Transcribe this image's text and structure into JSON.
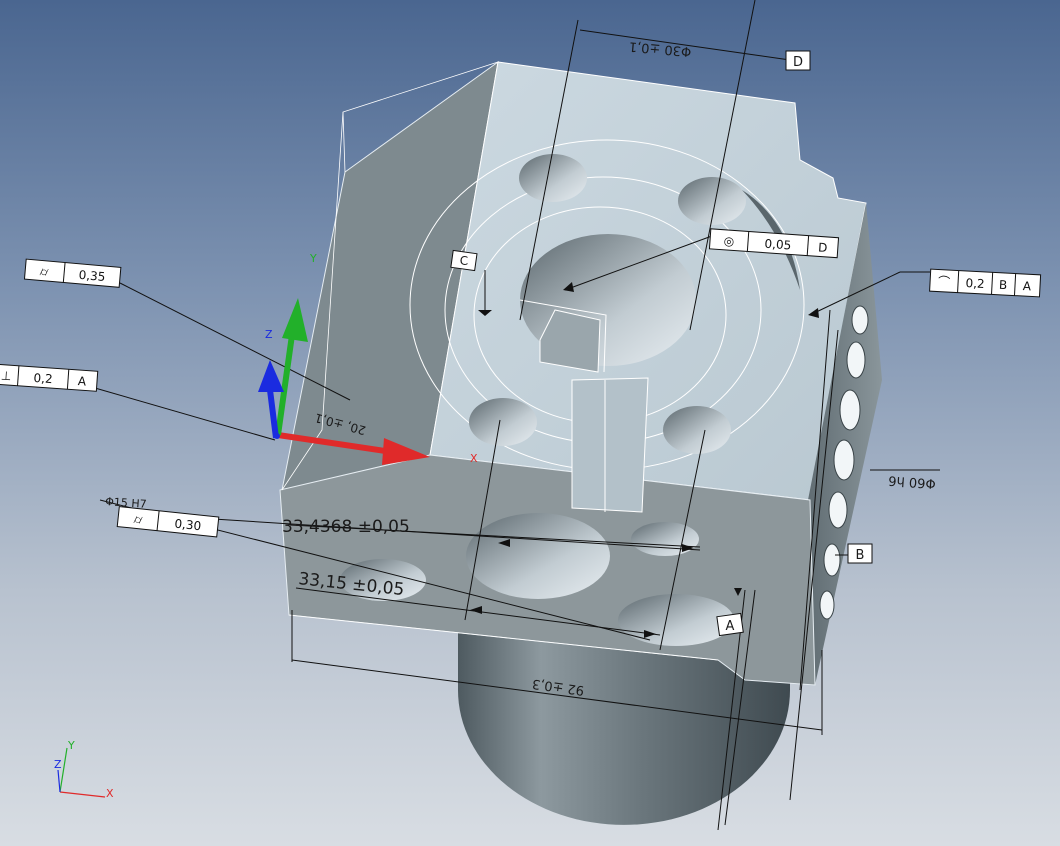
{
  "view": {
    "model_name": "",
    "colors": {
      "background_top": "#4a6690",
      "background_bottom": "#d8dde3",
      "top_face": "#c5d3dc",
      "side_face": "#7d8a90",
      "front_face": "#8b9599",
      "x_axis": "#e02a2a",
      "y_axis": "#22b02a",
      "z_axis": "#1a2be0"
    }
  },
  "triad": {
    "main": {
      "x_label": "X",
      "y_label": "Y",
      "z_label": "Z"
    },
    "corner": {
      "x_label": "X",
      "y_label": "Y",
      "z_label": "Z"
    }
  },
  "dimensions": {
    "d1": "Φ30  ±0,1",
    "d2": "33,4368   ±0,05",
    "d3": "33,15   ±0,05",
    "d4": "92  ±0,3",
    "d5": "Φ60  h6",
    "d6": "Φ15   H7",
    "d7": "20,  ±0,1"
  },
  "datums": {
    "a": "A",
    "b": "B",
    "c": "C",
    "d": "D"
  },
  "tolerance_frames": {
    "concentricity": {
      "symbol": "◎",
      "value": "0,05",
      "datum": "D"
    },
    "profile": {
      "symbol": "⌒",
      "value": "0,2",
      "datum1": "B",
      "datum2": "A"
    },
    "cylindricity_top": {
      "symbol": "⌭",
      "value": "0,35"
    },
    "perp_left": {
      "symbol": "⊥",
      "value": "0,2",
      "datum": "A"
    },
    "cylindricity_left": {
      "symbol": "⌭",
      "value": "0,30"
    }
  }
}
